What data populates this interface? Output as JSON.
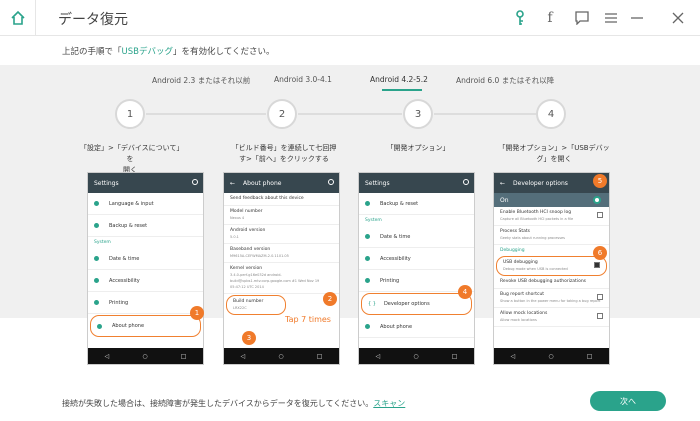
{
  "app": {
    "title": "データ復元"
  },
  "instruction": {
    "prefix": "上記の手順で「",
    "highlight": "USBデバッグ",
    "suffix": "」を有効化してください。"
  },
  "tabs": [
    "Android 2.3 またはそれ以前",
    "Android 3.0-4.1",
    "Android 4.2-5.2",
    "Android 6.0 またはそれ以降"
  ],
  "active_tab": 2,
  "steps": [
    {
      "num": "1",
      "caption_l1": "「設定」>「デバイスについて」を",
      "caption_l2": "開く"
    },
    {
      "num": "2",
      "caption_l1": "「ビルド番号」を連続して七回押",
      "caption_l2": "す>「前へ」をクリックする"
    },
    {
      "num": "3",
      "caption_l1": "「開発オプション」",
      "caption_l2": ""
    },
    {
      "num": "4",
      "caption_l1": "「開発オプション」>「USBデバッ",
      "caption_l2": "グ」を開く"
    }
  ],
  "phone1": {
    "title": "Settings",
    "items": [
      "Language & input",
      "Backup & reset"
    ],
    "section": "System",
    "items2": [
      "Date & time",
      "Accessibility",
      "Printing",
      "About phone"
    ]
  },
  "phone2": {
    "title": "About phone",
    "rows": [
      {
        "t": "Send feedback about this device",
        "s": ""
      },
      {
        "t": "Model number",
        "s": "Nexus 4"
      },
      {
        "t": "Android version",
        "s": "5.0.1"
      },
      {
        "t": "Baseband version",
        "s": "M9615A-CEFWMAZM-2.0.1101.05"
      },
      {
        "t": "Kernel version",
        "s": "3.4.0-perf-g16e032d android-build@vpbs1.mtv.corp.google.com #1 Wed Nov 19 05:47:12 UTC 2014"
      },
      {
        "t": "Build number",
        "s": "LRX22C"
      }
    ],
    "tap": "Tap 7 times"
  },
  "phone3": {
    "title": "Settings",
    "items": [
      "Backup & reset"
    ],
    "section": "System",
    "items2": [
      "Date & time",
      "Accessibility",
      "Printing",
      "Developer options",
      "About phone"
    ]
  },
  "phone4": {
    "title": "Developer options",
    "on": "On",
    "rows": [
      {
        "t": "Enable Bluetooth HCI snoop log",
        "s": "Capture all Bluetooth HCI packets in a file"
      },
      {
        "t": "Process Stats",
        "s": "Geeky stats about running processes"
      }
    ],
    "section": "Debugging",
    "usb": {
      "t": "USB debugging",
      "s": "Debug mode when USB is connected"
    },
    "rows2": [
      {
        "t": "Revoke USB debugging authorizations",
        "s": ""
      },
      {
        "t": "Bug report shortcut",
        "s": "Show a button in the power menu for taking a bug report"
      },
      {
        "t": "Allow mock locations",
        "s": "Allow mock locations"
      }
    ]
  },
  "badges": [
    "1",
    "2",
    "3",
    "4",
    "5",
    "6"
  ],
  "footer": {
    "text": "接続が失敗した場合は、接続障害が発生したデバイスからデータを復元してください。",
    "link": "スキャン"
  },
  "next_label": "次へ",
  "colors": {
    "accent": "#2aa38b",
    "badge": "#f07a2a"
  }
}
